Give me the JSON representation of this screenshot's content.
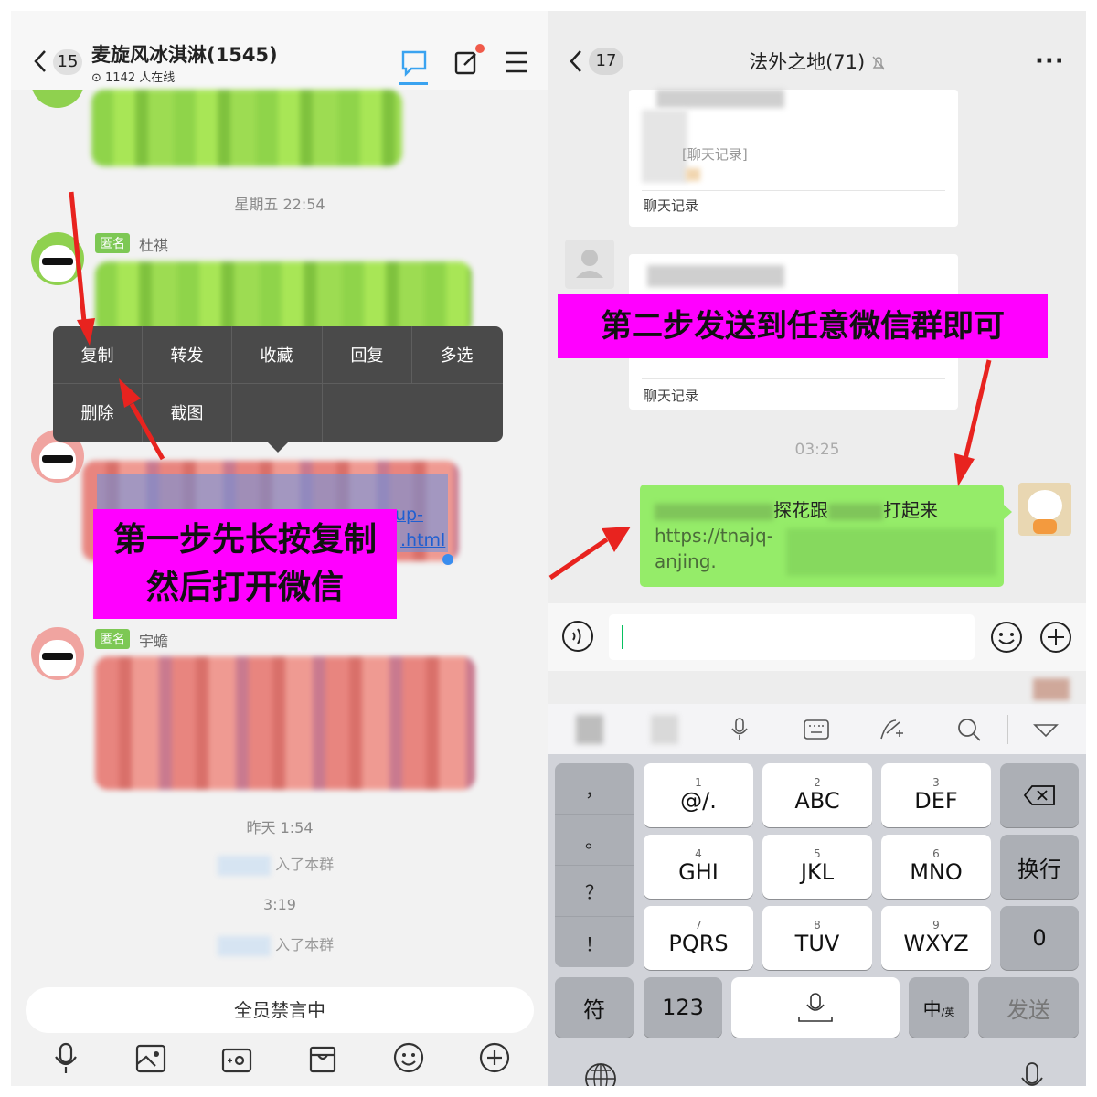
{
  "left_chat": {
    "back_count": "15",
    "title": "麦旋风冰淇淋(1545)",
    "online": "1142 人在线",
    "time_1": "星期五 22:54",
    "anon_label": "匿名",
    "sender_1": "杜祺",
    "sender_3": "宇蟾",
    "link_fragment_1": "up-",
    "link_fragment_2": ".html",
    "time_2": "昨天 1:54",
    "joined_1": "入了本群",
    "time_3": "3:19",
    "joined_2": "入了本群",
    "muted_bar": "全员禁言中",
    "context_menu": [
      "复制",
      "转发",
      "收藏",
      "回复",
      "多选",
      "删除",
      "截图"
    ],
    "annotation": [
      "第一步先长按复制",
      "然后打开微信"
    ]
  },
  "right_chat": {
    "back_count": "17",
    "title": "法外之地(71)",
    "record_label_1": "聊天记录",
    "record_label_inner": "[聊天记录]",
    "record_label_2": "聊天记录",
    "time": "03:25",
    "msg_line1_a": "探花跟",
    "msg_line1_b": "打起来",
    "msg_line2": "https://tnajq-",
    "msg_line3": "anjing.",
    "annotation": "第二步发送到任意微信群即可"
  },
  "keyboard": {
    "side_keys": [
      "，",
      "。",
      "？",
      "！"
    ],
    "keys": [
      {
        "num": "1",
        "label": "@/."
      },
      {
        "num": "2",
        "label": "ABC"
      },
      {
        "num": "3",
        "label": "DEF"
      },
      {
        "num": "4",
        "label": "GHI"
      },
      {
        "num": "5",
        "label": "JKL"
      },
      {
        "num": "6",
        "label": "MNO"
      },
      {
        "num": "7",
        "label": "PQRS"
      },
      {
        "num": "8",
        "label": "TUV"
      },
      {
        "num": "9",
        "label": "WXYZ"
      }
    ],
    "newline": "换行",
    "zero": "0",
    "symbols": "符",
    "numbers": "123",
    "lang": "中",
    "lang_sub": "/英",
    "send": "发送"
  },
  "colors": {
    "green_bubble": "#95ec69",
    "magenta": "#ff00ff",
    "red_arrow": "#e8231f",
    "tab_blue": "#3aa3f0"
  },
  "icons": [
    "chevron-left-icon",
    "chat-icon",
    "edit-icon",
    "menu-icon",
    "mic-icon",
    "image-icon",
    "camera-icon",
    "gift-icon",
    "emoji-icon",
    "plus-icon",
    "more-icon",
    "mute-bell-icon",
    "voice-icon",
    "keyboard-icon",
    "handwriting-icon",
    "search-icon",
    "collapse-icon",
    "backspace-icon",
    "globe-icon"
  ]
}
